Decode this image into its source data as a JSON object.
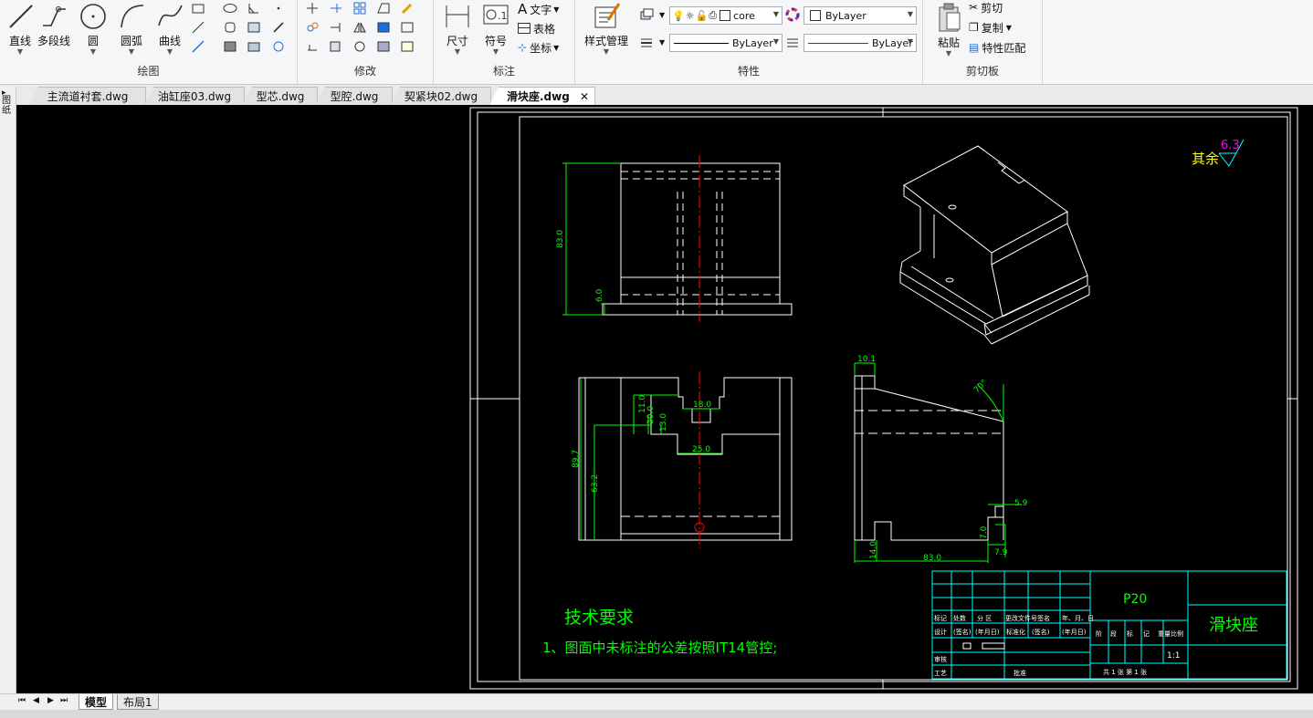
{
  "ribbon": {
    "draw": {
      "group_label": "绘图",
      "line": "直线",
      "polyline": "多段线",
      "circle": "圆",
      "arc": "圆弧",
      "curve": "曲线"
    },
    "modify": {
      "group_label": "修改"
    },
    "annotate": {
      "group_label": "标注",
      "dimension": "尺寸",
      "symbol": "符号",
      "text": "文字",
      "table": "表格",
      "coordinate": "坐标"
    },
    "style": {
      "style_manager": "样式管理"
    },
    "properties": {
      "group_label": "特性",
      "layer_name": "core",
      "color": "ByLayer",
      "linetype": "ByLayer",
      "lineweight": "ByLayer"
    },
    "clipboard": {
      "group_label": "剪切板",
      "paste": "粘贴",
      "cut": "剪切",
      "copy": "复制",
      "match_properties": "特性匹配"
    }
  },
  "doc_tabs": [
    {
      "label": "主流道衬套.dwg"
    },
    {
      "label": "油缸座03.dwg"
    },
    {
      "label": "型芯.dwg"
    },
    {
      "label": "型腔.dwg"
    },
    {
      "label": "契紧块02.dwg"
    },
    {
      "label": "滑块座.dwg",
      "active": true
    }
  ],
  "left_strip_label": "图纸",
  "layout_tabs": [
    {
      "label": "模型",
      "active": true
    },
    {
      "label": "布局1"
    }
  ],
  "drawing": {
    "roughness_prefix": "其余",
    "roughness_value": "6.3",
    "tech_title": "技术要求",
    "tech_item": "1、图面中未标注的公差按照IT14管控;",
    "part_number": "P20",
    "part_name": "滑块座",
    "scale": "1:1",
    "dims": {
      "front_height": "83.0",
      "front_step": "6.0",
      "side_total": "89.7",
      "side_inner": "63.2",
      "side_d1": "11.0",
      "side_d2": "20.0",
      "side_d3": "13.0",
      "slot_top": "18.0",
      "slot_bottom": "25.0",
      "top_w": "10.1",
      "angle": "70°",
      "right_h": "5.9",
      "right_v": "7.0",
      "right_w": "7.9",
      "bottom_h": "14.0",
      "bottom_len": "83.0"
    },
    "title_block": {
      "r1": [
        "标记",
        "处数",
        "分 区",
        "更改文件号",
        "签名",
        "年、月、日"
      ],
      "r2": [
        "设计",
        "(签名)",
        "(年月日)",
        "标准化",
        "(签名)",
        "(年月日)"
      ],
      "r3": [
        "审核"
      ],
      "r4": [
        "工艺",
        "批准"
      ],
      "stage": [
        "阶",
        "段",
        "标",
        "记",
        "重量",
        "比例"
      ],
      "sheets": "共 1 张    第 1 张"
    }
  },
  "colors": {
    "canvas": "#000000",
    "geometry": "#ffffff",
    "dimension": "#00ff00",
    "centerline": "#ff0000",
    "frame": "#ffffff",
    "titleblock": "#00ffff",
    "roughness": "#ffff00",
    "roughness_value": "#ff00ff"
  }
}
